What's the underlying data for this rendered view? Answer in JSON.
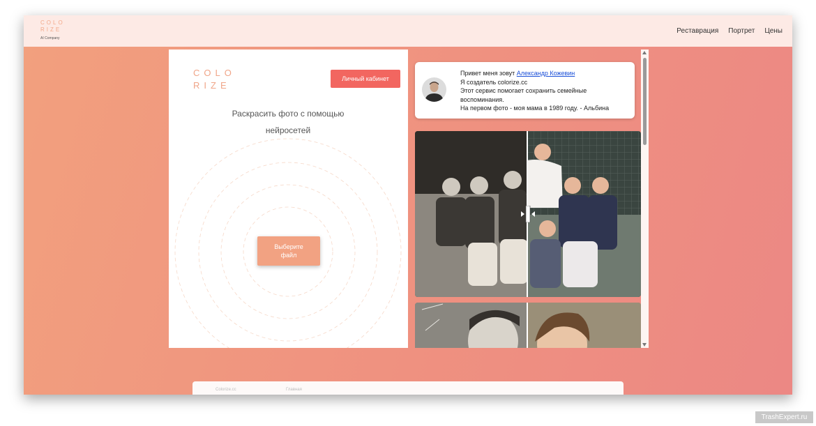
{
  "topbar": {
    "logo_line1": "COLO",
    "logo_line2": "RIZE",
    "logo_sub": "AI Company",
    "nav": [
      "Реставрация",
      "Портрет",
      "Цены"
    ]
  },
  "left_panel": {
    "logo_line1": "COLO",
    "logo_line2": "RIZE",
    "cabinet_button": "Личный кабинет",
    "headline_line1": "Раскрасить фото с помощью",
    "headline_line2": "нейросетей",
    "choose_line1": "Выберите",
    "choose_line2": "файл"
  },
  "info_card": {
    "greeting": "Привет меня зовут ",
    "author_link": "Александр Кожевин",
    "line2": "Я создатель colorize.cc",
    "line3": "Этот сервис помогает сохранить семейные воспоминания.",
    "line4": "На первом фото - моя мама в 1989 году. -  Альбина"
  },
  "bottom_bar": {
    "item1": "Colorize.cc",
    "item2": "Главная"
  },
  "watermark": "TrashExpert.ru",
  "colors": {
    "accent_red": "#f26660",
    "accent_peach": "#f2a282",
    "link": "#1a4fd8"
  },
  "icons": [
    "avatar-icon",
    "compare-handle-icon",
    "scroll-up-icon",
    "scroll-down-icon"
  ]
}
